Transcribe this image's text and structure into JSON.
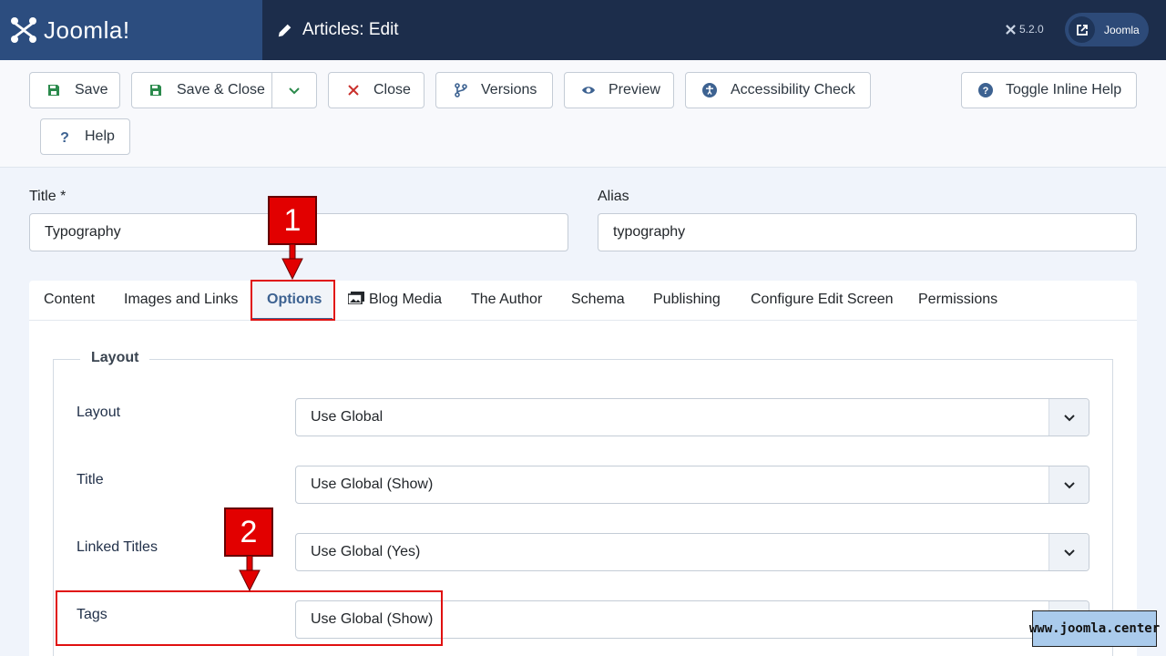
{
  "header": {
    "logo_text": "Joomla!",
    "page_title": "Articles: Edit",
    "version": "5.2.0",
    "site_button_label": "Joomla"
  },
  "toolbar": {
    "save": "Save",
    "save_close": "Save & Close",
    "close": "Close",
    "versions": "Versions",
    "preview": "Preview",
    "accessibility": "Accessibility Check",
    "toggle_help": "Toggle Inline Help",
    "help": "Help"
  },
  "form": {
    "title_label": "Title *",
    "title_value": "Typography",
    "alias_label": "Alias",
    "alias_value": "typography"
  },
  "tabs": [
    {
      "label": "Content"
    },
    {
      "label": "Images and Links"
    },
    {
      "label": "Options"
    },
    {
      "label": "Blog Media"
    },
    {
      "label": "The Author"
    },
    {
      "label": "Schema"
    },
    {
      "label": "Publishing"
    },
    {
      "label": "Configure Edit Screen"
    },
    {
      "label": "Permissions"
    }
  ],
  "active_tab": "Options",
  "layout_section": {
    "legend": "Layout",
    "fields": [
      {
        "label": "Layout",
        "value": "Use Global"
      },
      {
        "label": "Title",
        "value": "Use Global (Show)"
      },
      {
        "label": "Linked Titles",
        "value": "Use Global (Yes)"
      },
      {
        "label": "Tags",
        "value": "Use Global (Show)"
      }
    ]
  },
  "annotations": {
    "marker1": "1",
    "marker2": "2",
    "watermark": "www.joomla.center"
  },
  "colors": {
    "header_bg": "#1c2d4b",
    "logo_bg": "#2c4d7f",
    "accent": "#3d6291",
    "annotation_red": "#e20000"
  }
}
